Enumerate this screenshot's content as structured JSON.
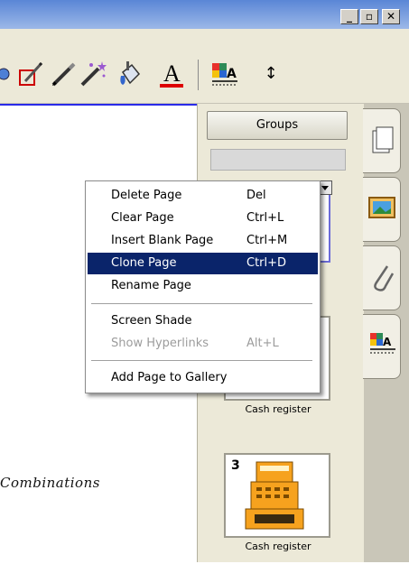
{
  "titlebar": {
    "buttons": [
      {
        "label": "_",
        "icon": "minimize-icon"
      },
      {
        "label": "▫",
        "icon": "restore-icon"
      },
      {
        "label": "✕",
        "icon": "close-icon"
      }
    ]
  },
  "toolbar": {
    "icons": [
      "circle-icon",
      "eraser-icon",
      "pen-icon",
      "magic-pen-icon",
      "fill-icon",
      "text-color-icon",
      "properties-icon",
      "move-icon"
    ],
    "text_color_glyph": "A",
    "properties_glyph": "A",
    "move_glyph": "↕"
  },
  "sidebar": {
    "groups_label": "Groups",
    "pages": [
      {
        "number": "",
        "label": "Cash register"
      },
      {
        "number": "3",
        "label": "Cash register"
      }
    ]
  },
  "tabs": [
    "page-sorter-icon",
    "gallery-icon",
    "attachments-icon",
    "properties-tab-icon"
  ],
  "context_menu": {
    "items": [
      {
        "label": "Delete Page",
        "shortcut": "Del"
      },
      {
        "label": "Clear Page",
        "shortcut": "Ctrl+L"
      },
      {
        "label": "Insert Blank Page",
        "shortcut": "Ctrl+M"
      },
      {
        "label": "Clone Page",
        "shortcut": "Ctrl+D",
        "selected": true
      },
      {
        "label": "Rename Page",
        "shortcut": ""
      },
      {
        "label": "Screen Shade",
        "shortcut": ""
      },
      {
        "label": "Show Hyperlinks",
        "shortcut": "Alt+L",
        "disabled": true
      },
      {
        "label": "Add Page to Gallery",
        "shortcut": ""
      }
    ]
  },
  "canvas": {
    "caption": "Combinations"
  },
  "colors": {
    "titlebar": "#5a86d6",
    "selection": "#0a246a",
    "panel": "#ece9d8"
  }
}
